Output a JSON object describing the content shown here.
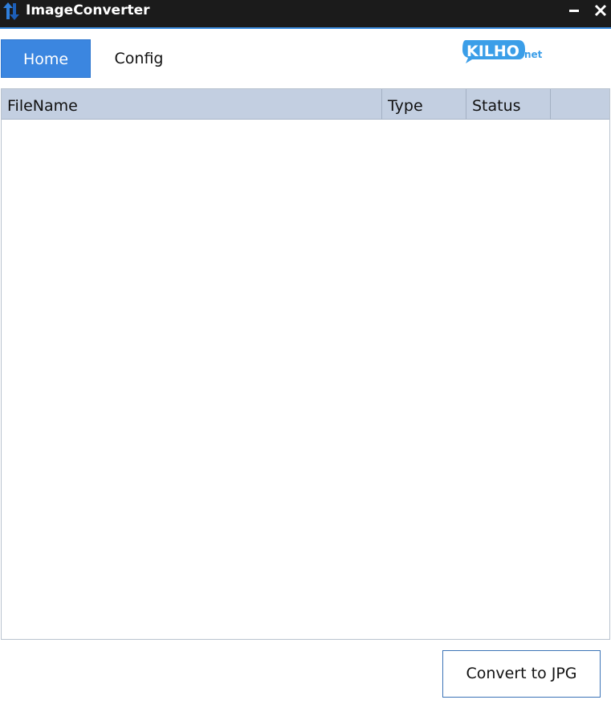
{
  "window": {
    "title": "ImageConverter",
    "icon": "app-arrows-icon",
    "minimize_icon": "minimize-icon",
    "close_icon": "close-icon",
    "accent_color": "#3b8de0"
  },
  "tabs": [
    {
      "label": "Home",
      "active": true
    },
    {
      "label": "Config",
      "active": false
    }
  ],
  "logo": {
    "text_main": "KILHO",
    "text_suffix": "net",
    "color": "#3b9ee8"
  },
  "table": {
    "columns": [
      "FileName",
      "Type",
      "Status"
    ],
    "rows": []
  },
  "actions": {
    "convert_label": "Convert to JPG"
  }
}
